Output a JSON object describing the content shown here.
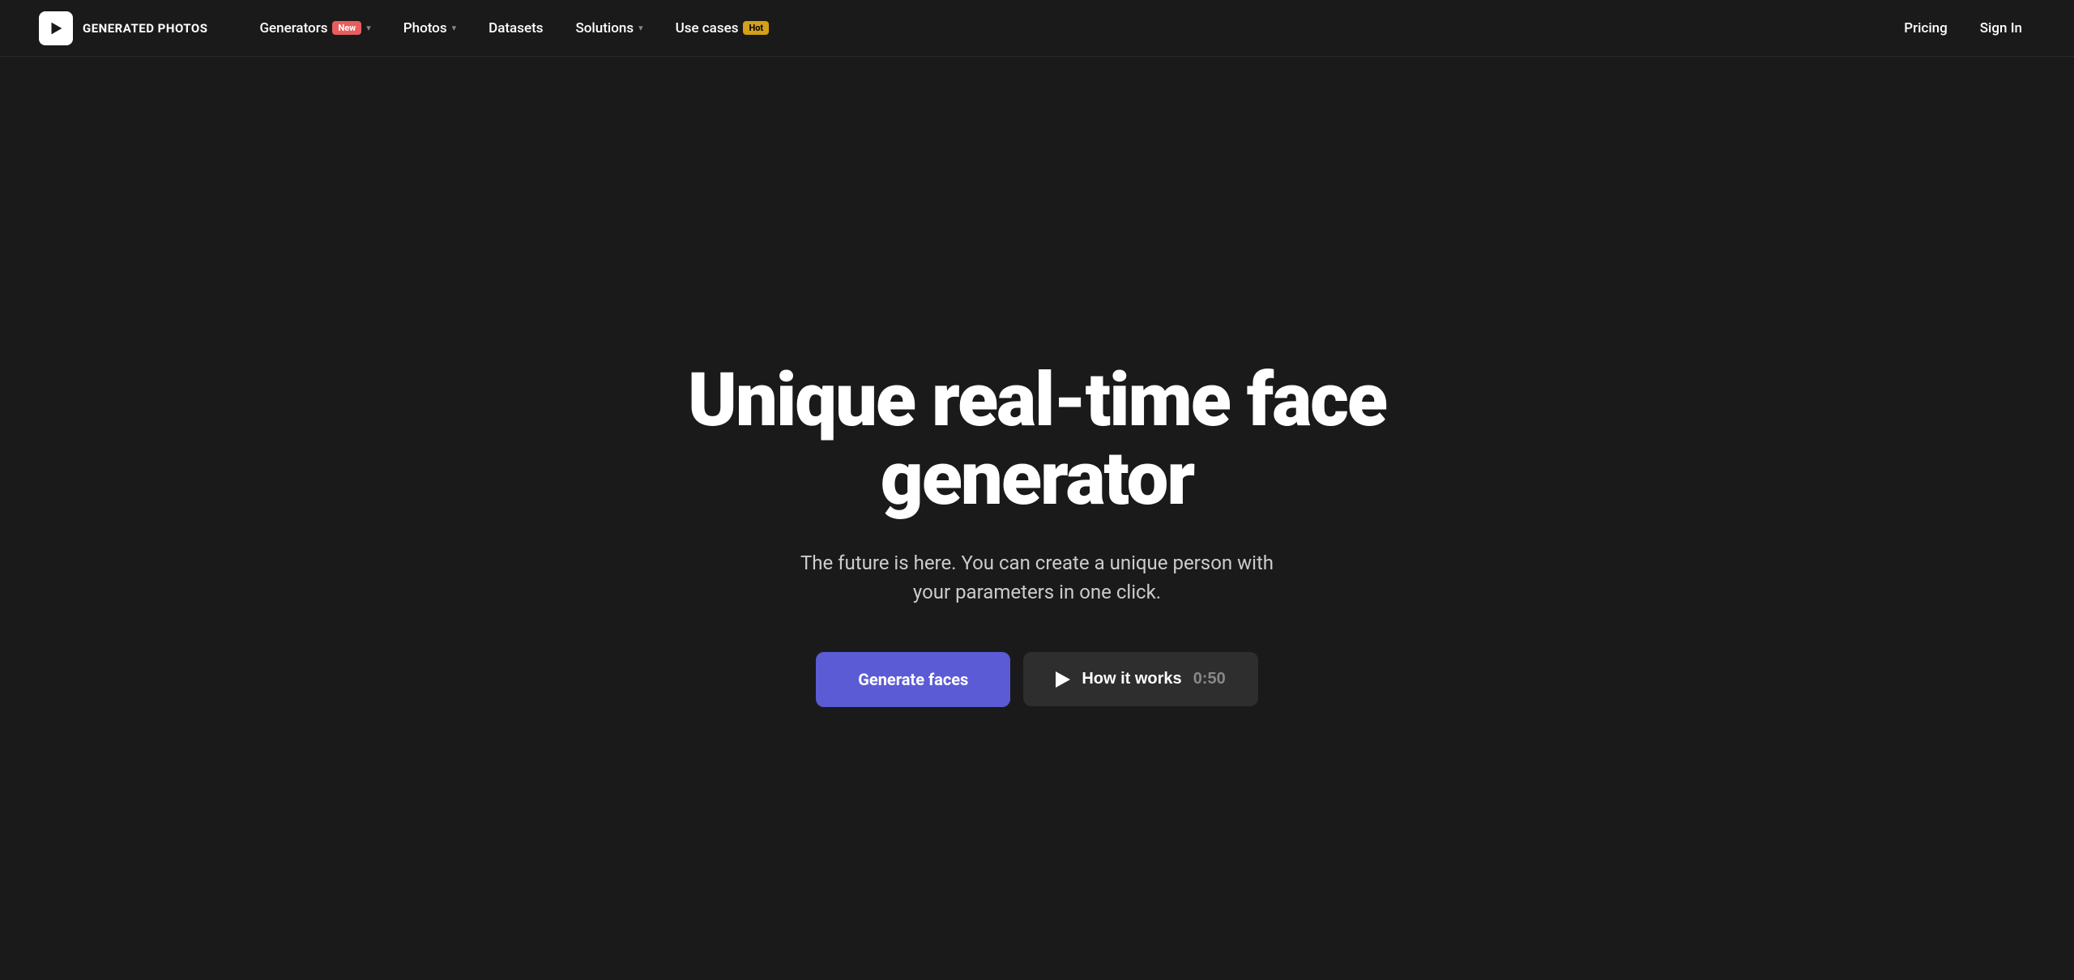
{
  "nav": {
    "logo_text": "GENERATED PHOTOS",
    "links": [
      {
        "id": "generators",
        "label": "Generators",
        "badge": "New",
        "badge_type": "new",
        "has_chevron": true
      },
      {
        "id": "photos",
        "label": "Photos",
        "badge": null,
        "badge_type": null,
        "has_chevron": true
      },
      {
        "id": "datasets",
        "label": "Datasets",
        "badge": null,
        "badge_type": null,
        "has_chevron": false
      },
      {
        "id": "solutions",
        "label": "Solutions",
        "badge": null,
        "badge_type": null,
        "has_chevron": true
      },
      {
        "id": "usecases",
        "label": "Use cases",
        "badge": "Hot",
        "badge_type": "hot",
        "has_chevron": false
      }
    ],
    "pricing_label": "Pricing",
    "signin_label": "Sign In"
  },
  "hero": {
    "title": "Unique real-time face generator",
    "subtitle": "The future is here. You can create a unique person with your parameters in one click.",
    "btn_generate": "Generate faces",
    "btn_how_it_works": "How it works",
    "btn_duration": "0:50"
  },
  "colors": {
    "background": "#1a1a1a",
    "accent_blue": "#5b5bd6",
    "badge_new": "#e85d5d",
    "badge_hot": "#d4a017",
    "btn_secondary": "#2e2e2e"
  }
}
